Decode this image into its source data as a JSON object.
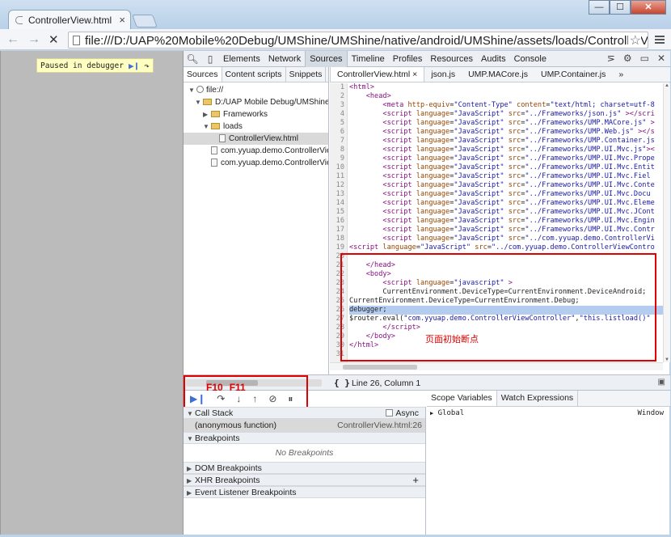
{
  "window": {
    "tab_title": "ControllerView.html",
    "min": "—",
    "max": "☐",
    "close": "✕"
  },
  "toolbar": {
    "back": "←",
    "forward": "→",
    "stop": "✕",
    "url": "file:///D:/UAP%20Mobile%20Debug/UMShine/UMShine/native/android/UMShine/assets/loads/ControllerView.h",
    "star": "☆"
  },
  "page": {
    "paused_label": "Paused in debugger"
  },
  "devtools": {
    "tabs": [
      "Elements",
      "Network",
      "Sources",
      "Timeline",
      "Profiles",
      "Resources",
      "Audits",
      "Console"
    ],
    "active_tab": "Sources",
    "sources_subtabs": [
      "Sources",
      "Content scripts",
      "Snippets"
    ],
    "tree": [
      "file://",
      "D:/UAP Mobile Debug/UMShine/",
      "Frameworks",
      "loads",
      "ControllerView.html",
      "com.yyuap.demo.ControllerView",
      "com.yyuap.demo.ControllerView"
    ],
    "editor_tabs": [
      "ControllerView.html",
      "json.js",
      "UMP.MACore.js",
      "UMP.Container.js"
    ],
    "more_tabs": "»",
    "status": {
      "braces": "{ }",
      "position": "Line 26, Column 1"
    },
    "annotation": {
      "breakpoint_note": "页面初始断点",
      "f10": "F10",
      "f11": "F11"
    },
    "sections": {
      "call_stack": "Call Stack",
      "async": "Async",
      "frame_name": "(anonymous function)",
      "frame_loc": "ControllerView.html:26",
      "breakpoints": "Breakpoints",
      "no_breakpoints": "No Breakpoints",
      "dom_breakpoints": "DOM Breakpoints",
      "xhr_breakpoints": "XHR Breakpoints",
      "event_breakpoints": "Event Listener Breakpoints"
    },
    "scope_tabs": [
      "Scope Variables",
      "Watch Expressions"
    ],
    "scope_row": {
      "name": "Global",
      "value": "Window"
    }
  }
}
